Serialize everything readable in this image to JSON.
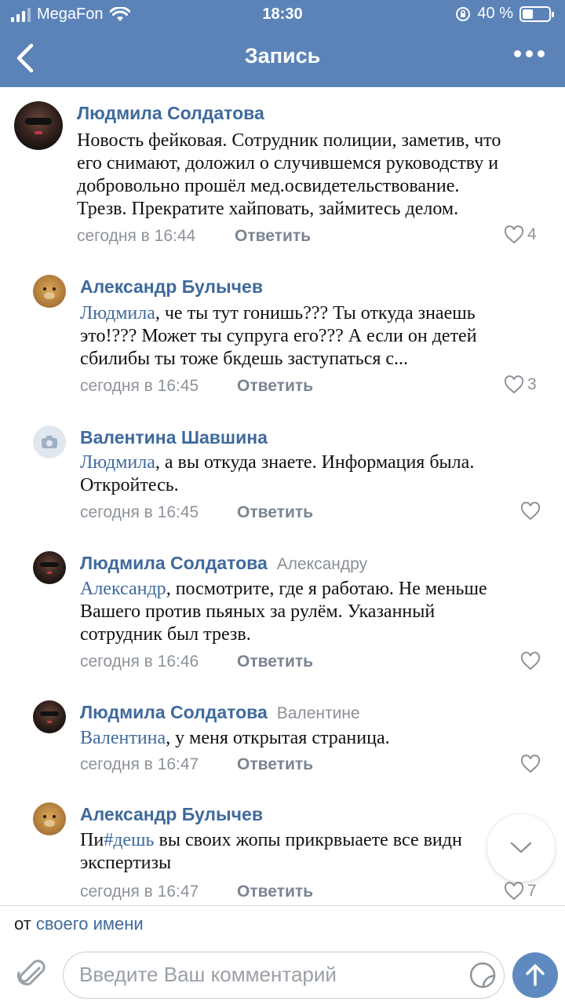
{
  "status_bar": {
    "carrier": "MegaFon",
    "time": "18:30",
    "battery_text": "40 %",
    "battery_level": 0.4
  },
  "navbar": {
    "title": "Запись"
  },
  "comments": [
    {
      "author": "Людмила Солдатова",
      "reply_to": "",
      "mention": "",
      "lines": [
        "Новость фейковая. Сотрудник полиции, заметив, что",
        "его снимают, доложил о случившемся руководству и",
        "добровольно прошёл мед.освидетельствование.",
        "Трезв. Прекратите хайповать, займитесь делом."
      ],
      "time": "сегодня в 16:44",
      "reply_label": "Ответить",
      "likes": "4"
    },
    {
      "author": "Александр Булычев",
      "reply_to": "",
      "mention": "Людмила",
      "lines": [
        ", че ты тут гонишь??? Ты откуда знаешь",
        "это!??? Может ты супруга его??? А если он детей",
        "сбилибы ты тоже бкдешь заступаться с..."
      ],
      "time": "сегодня в 16:45",
      "reply_label": "Ответить",
      "likes": "3"
    },
    {
      "author": "Валентина Шавшина",
      "reply_to": "",
      "mention": "Людмила",
      "lines": [
        ", а вы откуда знаете. Информация была.",
        "Откройтесь."
      ],
      "time": "сегодня в 16:45",
      "reply_label": "Ответить",
      "likes": ""
    },
    {
      "author": "Людмила Солдатова",
      "reply_to": "Александру",
      "mention": "Александр",
      "lines": [
        ", посмотрите, где я работаю. Не меньше",
        "Вашего против пьяных за рулём. Указанный",
        "сотрудник был трезв."
      ],
      "time": "сегодня в 16:46",
      "reply_label": "Ответить",
      "likes": ""
    },
    {
      "author": "Людмила Солдатова",
      "reply_to": "Валентине",
      "mention": "Валентина",
      "lines": [
        ", у меня открытая страница."
      ],
      "time": "сегодня в 16:47",
      "reply_label": "Ответить",
      "likes": ""
    },
    {
      "author": "Александр Булычев",
      "reply_to": "",
      "mention": "",
      "text_prefix": "Пи",
      "hashtag": "#дешь",
      "lines": [
        " вы своих жопы прикрвыаете все видн",
        "экспертизы"
      ],
      "time": "сегодня в 16:47",
      "reply_label": "Ответить",
      "likes": "7"
    }
  ],
  "from_bar": {
    "prefix": "от",
    "link": "своего имени"
  },
  "composer": {
    "placeholder": "Введите Ваш комментарий"
  },
  "colors": {
    "header": "#5b83b8",
    "link": "#3f6a9c",
    "send": "#5e8ac0"
  }
}
